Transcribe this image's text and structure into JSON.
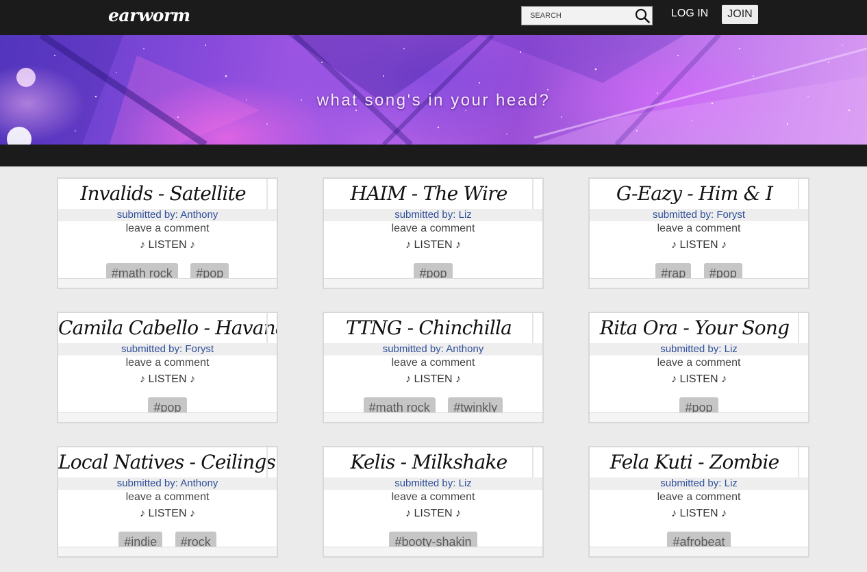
{
  "header": {
    "logo": "earworm",
    "search_placeholder": "SEARCH",
    "login_label": "LOG IN",
    "join_label": "JOIN"
  },
  "hero": {
    "tagline": "what song's in your head?"
  },
  "cards": [
    {
      "title": "Invalids - Satellite",
      "submitted": "submitted by: Anthony",
      "comment": "leave a comment",
      "listen": "♪ LISTEN ♪",
      "tags": [
        "#math rock",
        "#pop"
      ]
    },
    {
      "title": "HAIM - The Wire",
      "submitted": "submitted by: Liz",
      "comment": "leave a comment",
      "listen": "♪ LISTEN ♪",
      "tags": [
        "#pop"
      ]
    },
    {
      "title": "G-Eazy - Him & I",
      "submitted": "submitted by: Foryst",
      "comment": "leave a comment",
      "listen": "♪ LISTEN ♪",
      "tags": [
        "#rap",
        "#pop"
      ]
    },
    {
      "title": "Camila Cabello - Havana",
      "submitted": "submitted by: Foryst",
      "comment": "leave a comment",
      "listen": "♪ LISTEN ♪",
      "tags": [
        "#pop"
      ]
    },
    {
      "title": "TTNG - Chinchilla",
      "submitted": "submitted by: Anthony",
      "comment": "leave a comment",
      "listen": "♪ LISTEN ♪",
      "tags": [
        "#math rock",
        "#twinkly"
      ]
    },
    {
      "title": "Rita Ora - Your Song",
      "submitted": "submitted by: Liz",
      "comment": "leave a comment",
      "listen": "♪ LISTEN ♪",
      "tags": [
        "#pop"
      ]
    },
    {
      "title": "Local Natives - Ceilings",
      "submitted": "submitted by: Anthony",
      "comment": "leave a comment",
      "listen": "♪ LISTEN ♪",
      "tags": [
        "#indie",
        "#rock"
      ]
    },
    {
      "title": "Kelis - Milkshake",
      "submitted": "submitted by: Liz",
      "comment": "leave a comment",
      "listen": "♪ LISTEN ♪",
      "tags": [
        "#booty-shakin"
      ]
    },
    {
      "title": "Fela Kuti - Zombie",
      "submitted": "submitted by: Liz",
      "comment": "leave a comment",
      "listen": "♪ LISTEN ♪",
      "tags": [
        "#afrobeat"
      ]
    }
  ],
  "colors": {
    "nav_background": "#1b1b1b",
    "page_background": "#ebebeb",
    "submitter_link": "#2f4f9a",
    "tag_background": "#c6c6c6"
  },
  "icons": {
    "search": "search-icon"
  }
}
